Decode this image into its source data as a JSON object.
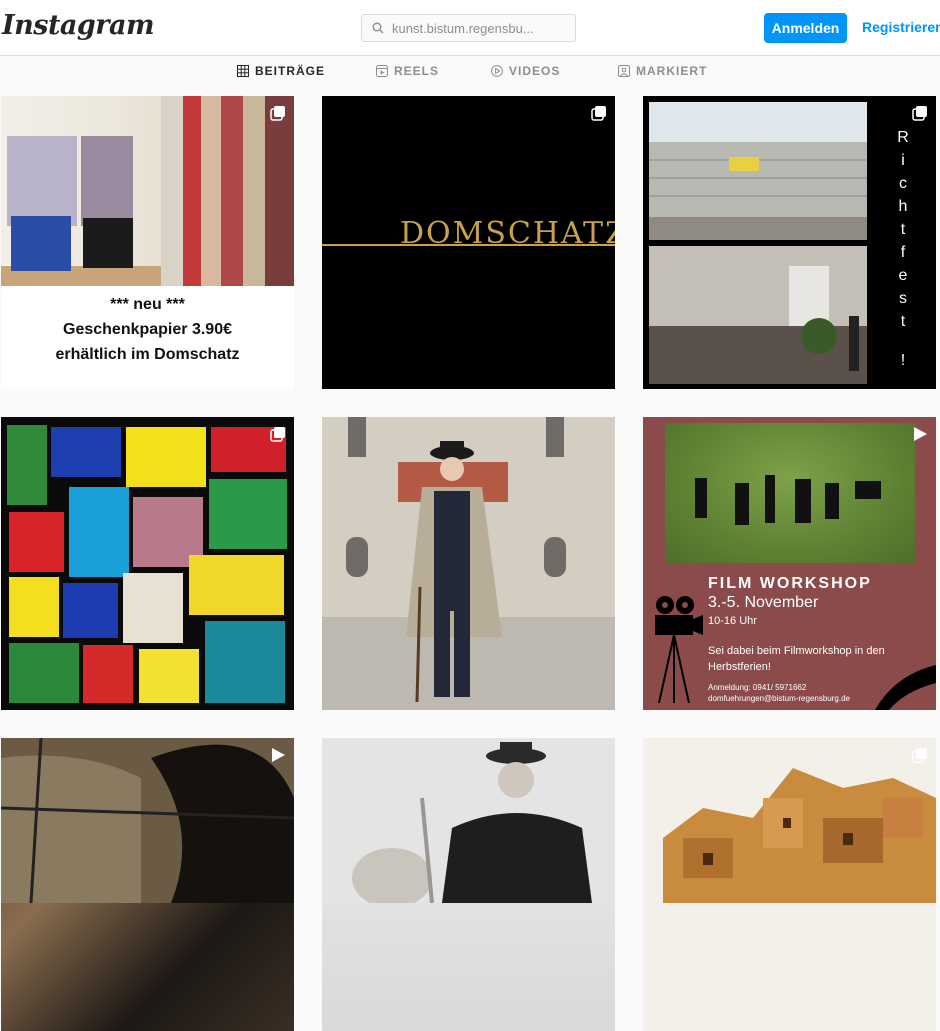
{
  "header": {
    "logo": "Instagram",
    "search_placeholder": "kunst.bistum.regensbu...",
    "login_label": "Anmelden",
    "register_label": "Registrieren"
  },
  "tabs": [
    {
      "label": "BEITRÄGE",
      "icon": "grid-icon",
      "active": true
    },
    {
      "label": "REELS",
      "icon": "reels-icon",
      "active": false
    },
    {
      "label": "VIDEOS",
      "icon": "video-icon",
      "active": false
    },
    {
      "label": "MARKIERT",
      "icon": "tagged-icon",
      "active": false
    }
  ],
  "posts": [
    {
      "type": "carousel",
      "caption_lines": [
        "*** neu ***",
        "Geschenkpapier 3.90€",
        "erhältlich im Domschatz"
      ]
    },
    {
      "type": "carousel",
      "logo_text": "DOMSCHATZ"
    },
    {
      "type": "carousel",
      "vertical_text": [
        "R",
        "i",
        "c",
        "h",
        "t",
        "f",
        "e",
        "s",
        "t",
        "!"
      ]
    },
    {
      "type": "carousel"
    },
    {
      "type": "image"
    },
    {
      "type": "video",
      "title": "FILM WORKSHOP",
      "date": "3.-5. November",
      "time": "10-16 Uhr",
      "description": "Sei dabei beim Filmworkshop in den Herbstferien!",
      "registration_phone": "Anmeldung: 0941/ 5971662",
      "registration_email": "domfuehrungen@bistum-regensburg.de"
    },
    {
      "type": "video"
    },
    {
      "type": "image"
    },
    {
      "type": "carousel"
    }
  ],
  "colors": {
    "accent": "#0095f6",
    "gold": "#c8a24a",
    "workshop_bg": "#8b4b4b"
  }
}
